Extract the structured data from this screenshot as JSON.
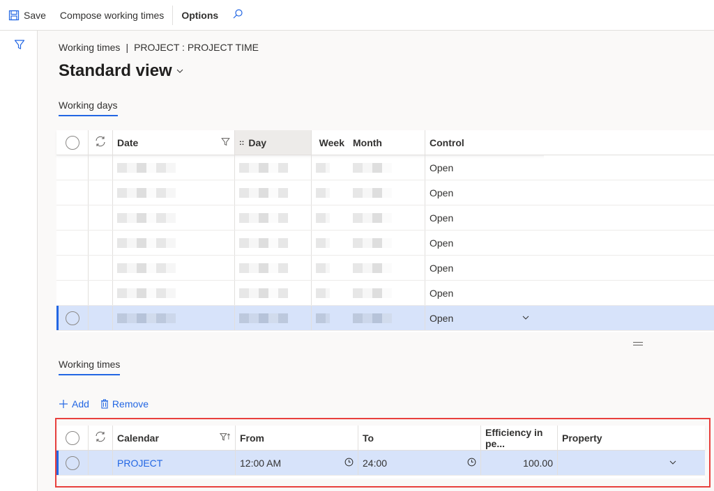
{
  "toolbar": {
    "save_label": "Save",
    "compose_label": "Compose working times",
    "options_label": "Options",
    "icons": {
      "save": "save-icon",
      "search": "search-icon"
    }
  },
  "leftrail": {
    "filter_icon": "filter-icon"
  },
  "breadcrumb": {
    "page": "Working times",
    "separator": "|",
    "record": "PROJECT : PROJECT TIME"
  },
  "view": {
    "title": "Standard view"
  },
  "working_days": {
    "tab_label": "Working days",
    "columns": {
      "date": "Date",
      "day": "Day",
      "week": "Week",
      "month": "Month",
      "control": "Control"
    },
    "rows": [
      {
        "date": "",
        "day": "",
        "week": "",
        "month": "",
        "control": "Open",
        "selected": false
      },
      {
        "date": "",
        "day": "",
        "week": "",
        "month": "",
        "control": "Open",
        "selected": false
      },
      {
        "date": "",
        "day": "",
        "week": "",
        "month": "",
        "control": "Open",
        "selected": false
      },
      {
        "date": "",
        "day": "",
        "week": "",
        "month": "",
        "control": "Open",
        "selected": false
      },
      {
        "date": "",
        "day": "",
        "week": "",
        "month": "",
        "control": "Open",
        "selected": false
      },
      {
        "date": "",
        "day": "",
        "week": "",
        "month": "",
        "control": "Open",
        "selected": false
      },
      {
        "date": "",
        "day": "",
        "week": "",
        "month": "",
        "control": "Open",
        "selected": true
      }
    ]
  },
  "working_times": {
    "tab_label": "Working times",
    "add_label": "Add",
    "remove_label": "Remove",
    "columns": {
      "calendar": "Calendar",
      "from": "From",
      "to": "To",
      "efficiency": "Efficiency in pe...",
      "property": "Property"
    },
    "rows": [
      {
        "calendar": "PROJECT",
        "from": "12:00 AM",
        "to": "24:00",
        "efficiency": "100.00",
        "property": "",
        "selected": true
      }
    ]
  },
  "colors": {
    "accent": "#2266e3",
    "selected_row": "#d7e3fa",
    "highlight_box": "#e8403d"
  }
}
